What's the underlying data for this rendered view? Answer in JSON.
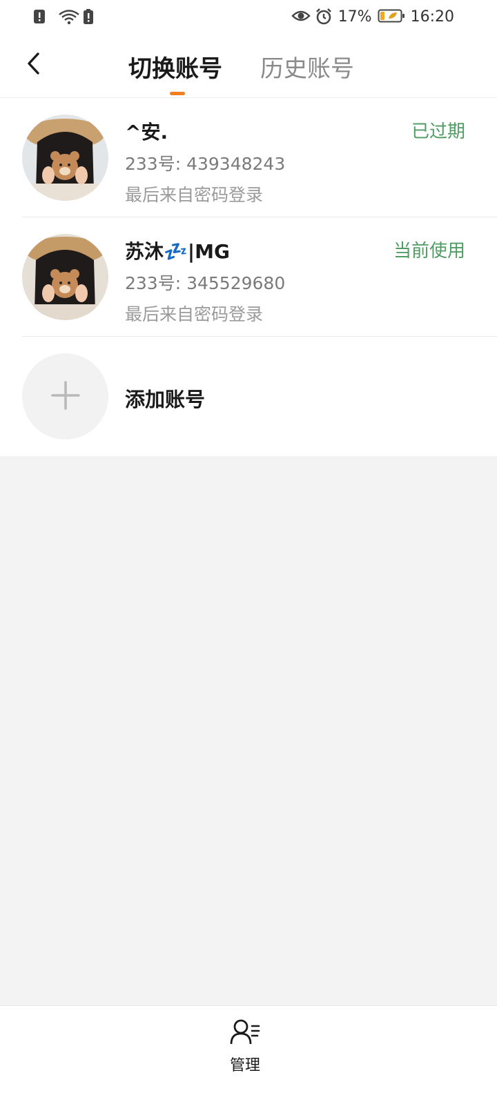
{
  "status_bar": {
    "battery_percent": "17%",
    "time": "16:20",
    "icons": [
      "sim-alert-icon",
      "wifi-icon",
      "battery-saver-icon",
      "eye-icon",
      "alarm-icon",
      "battery-icon"
    ]
  },
  "header": {
    "tabs": [
      {
        "label": "切换账号",
        "active": true
      },
      {
        "label": "历史账号",
        "active": false
      }
    ],
    "indicator_color": "#f07f21"
  },
  "accounts": [
    {
      "name": "^安.",
      "id_text": "233号: 439348243",
      "login_text": "最后来自密码登录",
      "status": "已过期"
    },
    {
      "name": "苏沐💤|MG",
      "id_text": "233号: 345529680",
      "login_text": "最后来自密码登录",
      "status": "当前使用"
    }
  ],
  "add_account": {
    "label": "添加账号"
  },
  "bottom_bar": {
    "manage_label": "管理"
  },
  "colors": {
    "status_green": "#4f9d62",
    "accent_orange": "#f07f21",
    "background": "#f3f3f3"
  }
}
